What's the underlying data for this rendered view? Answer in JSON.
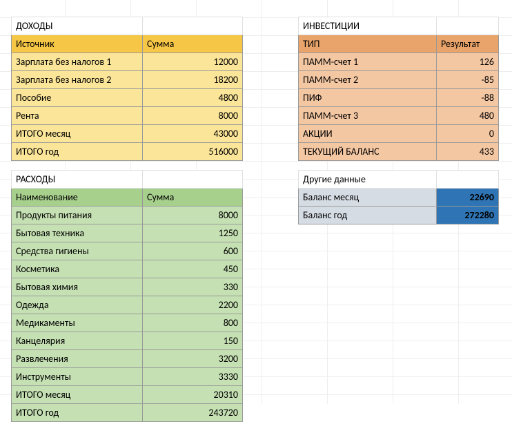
{
  "income": {
    "title": "ДОХОДЫ",
    "header_label": "Источник",
    "header_value": "Сумма",
    "rows": [
      {
        "label": "Зарплата без налогов 1",
        "value": "12000"
      },
      {
        "label": "Зарплата без налогов 2",
        "value": "18200"
      },
      {
        "label": "Пособие",
        "value": "4800"
      },
      {
        "label": "Рента",
        "value": "8000"
      },
      {
        "label": "ИТОГО месяц",
        "value": "43000"
      },
      {
        "label": "ИТОГО год",
        "value": "516000"
      }
    ]
  },
  "expenses": {
    "title": "РАСХОДЫ",
    "header_label": "Наименование",
    "header_value": "Сумма",
    "rows": [
      {
        "label": "Продукты питания",
        "value": "8000"
      },
      {
        "label": "Бытовая техника",
        "value": "1250"
      },
      {
        "label": "Средства гигиены",
        "value": "600"
      },
      {
        "label": "Косметика",
        "value": "450"
      },
      {
        "label": "Бытовая химия",
        "value": "330"
      },
      {
        "label": "Одежда",
        "value": "2200"
      },
      {
        "label": "Медикаменты",
        "value": "800"
      },
      {
        "label": "Канцелярия",
        "value": "150"
      },
      {
        "label": "Развлечения",
        "value": "3200"
      },
      {
        "label": "Инструменты",
        "value": "3330"
      },
      {
        "label": "ИТОГО месяц",
        "value": "20310"
      },
      {
        "label": "ИТОГО год",
        "value": "243720"
      }
    ]
  },
  "investments": {
    "title": "ИНВЕСТИЦИИ",
    "header_label": "ТИП",
    "header_value": "Результат",
    "rows": [
      {
        "label": "ПАММ-счет 1",
        "value": "126"
      },
      {
        "label": "ПАММ-счет 2",
        "value": "-85"
      },
      {
        "label": "ПИФ",
        "value": "-88"
      },
      {
        "label": "ПАММ-счет 3",
        "value": "480"
      },
      {
        "label": "АКЦИИ",
        "value": "0"
      },
      {
        "label": "ТЕКУЩИЙ БАЛАНС",
        "value": "433"
      }
    ]
  },
  "other": {
    "title": "Другие данные",
    "rows": [
      {
        "label": "Баланс месяц",
        "value": "22690"
      },
      {
        "label": "Баланс год",
        "value": "272280"
      }
    ]
  }
}
